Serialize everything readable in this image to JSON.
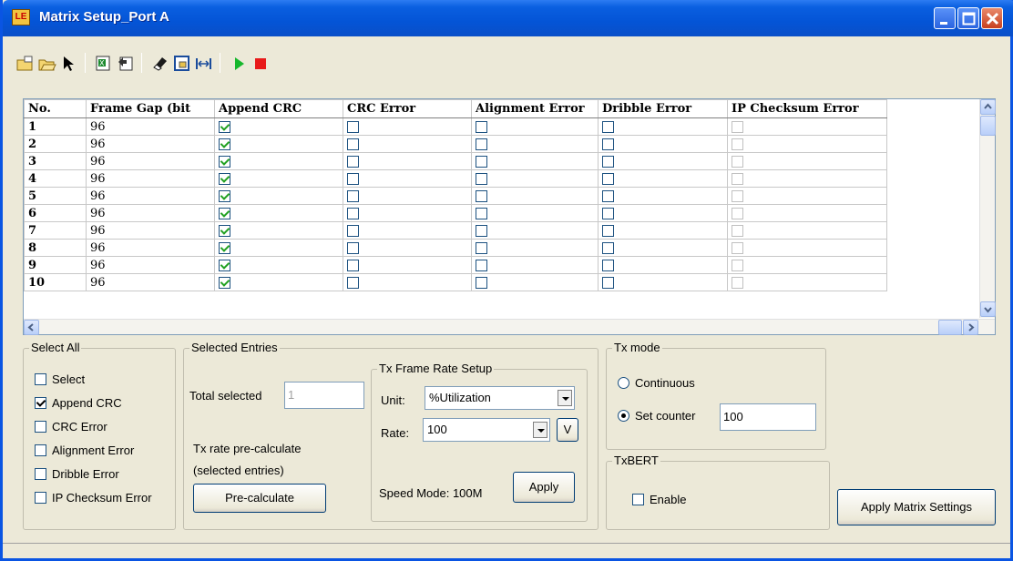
{
  "window": {
    "title": "Matrix Setup_Port A",
    "icon_text": "LE"
  },
  "toolbar": {
    "icons": [
      "open-file-icon",
      "open-folder-icon",
      "pointer-icon",
      "excel-export-icon",
      "excel-import-icon",
      "eraser-icon",
      "select-window-icon",
      "fit-width-icon",
      "play-icon",
      "stop-icon"
    ]
  },
  "grid": {
    "columns": [
      "No.",
      "Frame Gap (bit",
      "Append CRC",
      "CRC Error",
      "Alignment Error",
      "Dribble Error",
      "IP Checksum Error"
    ],
    "rows": [
      {
        "no": "1",
        "gap": "96"
      },
      {
        "no": "2",
        "gap": "96"
      },
      {
        "no": "3",
        "gap": "96"
      },
      {
        "no": "4",
        "gap": "96"
      },
      {
        "no": "5",
        "gap": "96"
      },
      {
        "no": "6",
        "gap": "96"
      },
      {
        "no": "7",
        "gap": "96"
      },
      {
        "no": "8",
        "gap": "96"
      },
      {
        "no": "9",
        "gap": "96"
      },
      {
        "no": "10",
        "gap": "96"
      }
    ]
  },
  "select_all": {
    "title": "Select All",
    "items": [
      {
        "label": "Select",
        "checked": false
      },
      {
        "label": "Append CRC",
        "checked": true
      },
      {
        "label": "CRC Error",
        "checked": false
      },
      {
        "label": "Alignment Error",
        "checked": false
      },
      {
        "label": "Dribble Error",
        "checked": false
      },
      {
        "label": "IP Checksum Error",
        "checked": false
      }
    ]
  },
  "selected_entries": {
    "title": "Selected Entries",
    "total_label": "Total selected",
    "total_value": "1",
    "precalc_line1": "Tx rate pre-calculate",
    "precalc_line2": "(selected entries)",
    "precalc_button": "Pre-calculate"
  },
  "tx_rate": {
    "title": "Tx Frame Rate Setup",
    "unit_label": "Unit:",
    "unit_value": "%Utilization",
    "rate_label": "Rate:",
    "rate_value": "100",
    "v_button": "V",
    "speed_mode": "Speed Mode: 100M",
    "apply_button": "Apply"
  },
  "tx_mode": {
    "title": "Tx mode",
    "continuous_label": "Continuous",
    "set_counter_label": "Set counter",
    "counter_value": "100",
    "selected": "set_counter"
  },
  "txbert": {
    "title": "TxBERT",
    "enable_label": "Enable",
    "enabled": false
  },
  "apply_matrix_button": "Apply Matrix Settings"
}
